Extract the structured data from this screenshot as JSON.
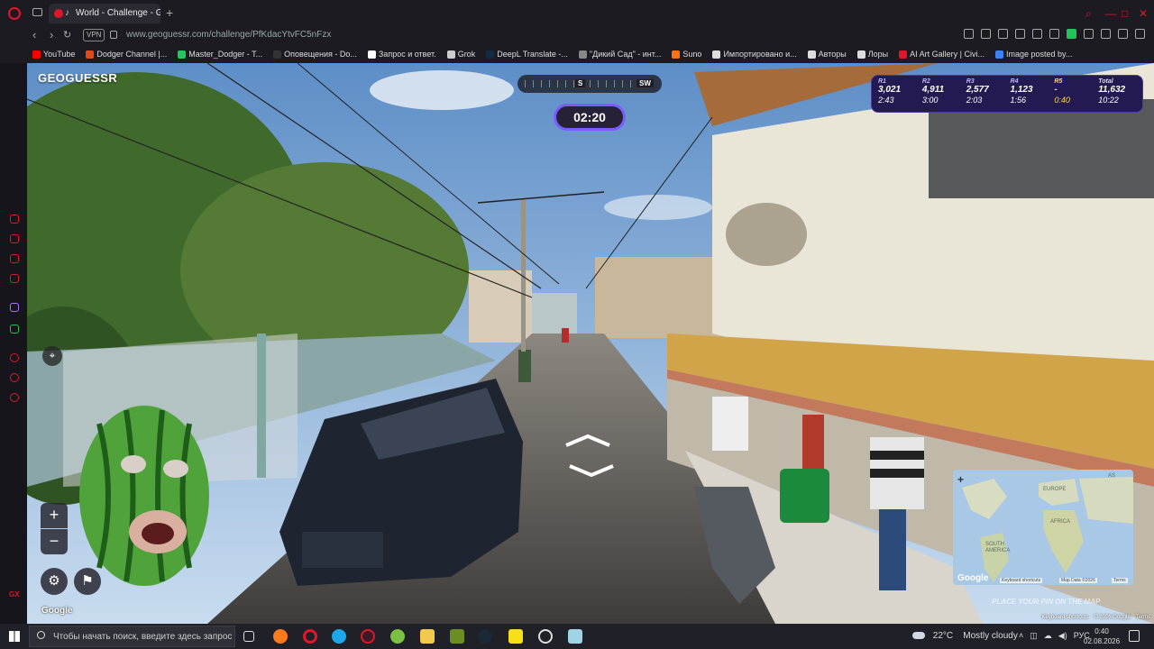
{
  "browser": {
    "tab_title": "World - Challenge - Geo",
    "url": "www.geoguessr.com/challenge/PfKdacYtvFC5nFzx",
    "vpn_label": "VPN",
    "new_tab": "+"
  },
  "bookmarks": [
    {
      "label": "YouTube",
      "color": "#ff0000"
    },
    {
      "label": "Dodger Channel |...",
      "color": "#e04a1a"
    },
    {
      "label": "Master_Dodger - T...",
      "color": "#22c55e"
    },
    {
      "label": "Оповещения - Do...",
      "color": "#333333"
    },
    {
      "label": "Запрос и ответ.",
      "color": "#ffffff"
    },
    {
      "label": "Grok",
      "color": "#cccccc"
    },
    {
      "label": "DeepL Translate -...",
      "color": "#0f2b46"
    },
    {
      "label": "\"Дикий Сад\" - инт...",
      "color": "#888888"
    },
    {
      "label": "Suno",
      "color": "#f97316"
    },
    {
      "label": "Импортировано и...",
      "color": "#dddddd"
    },
    {
      "label": "Авторы",
      "color": "#dddddd"
    },
    {
      "label": "Лоры",
      "color": "#dddddd"
    },
    {
      "label": "AI Art Gallery | Civi...",
      "color": "#e0162b"
    },
    {
      "label": "Image posted by...",
      "color": "#3b82f6"
    }
  ],
  "game": {
    "logo": "GEOGUESSR",
    "compass": {
      "s": "S",
      "sw": "SW"
    },
    "timer": "02:20",
    "rounds": [
      {
        "label": "R1",
        "points": "3,021",
        "time": "2:43"
      },
      {
        "label": "R2",
        "points": "4,911",
        "time": "3:00"
      },
      {
        "label": "R3",
        "points": "2,577",
        "time": "2:03"
      },
      {
        "label": "R4",
        "points": "1,123",
        "time": "1:56"
      },
      {
        "label": "R5",
        "points": "-",
        "time": "0:40"
      }
    ],
    "total": {
      "label": "Total",
      "points": "11,632",
      "time": "10:22"
    },
    "zoom_in": "+",
    "zoom_out": "−",
    "google_mark": "Google",
    "minimap": {
      "plus": "+",
      "europe": "EUROPE",
      "africa": "AFRICA",
      "south_america": "SOUTH AMERICA",
      "asia": "AS",
      "google": "Google",
      "shortcuts": "Keyboard shortcuts",
      "map_data": "Map Data ©2026",
      "terms": "Terms"
    },
    "place_pin": "PLACE YOUR PIN ON THE MAP",
    "footer": {
      "shortcuts": "Keyboard shortcuts",
      "copyright": "© 2026 Google",
      "terms": "Terms"
    }
  },
  "taskbar": {
    "search_placeholder": "Чтобы начать поиск, введите здесь запрос",
    "temperature": "22°C",
    "weather": "Mostly cloudy",
    "lang": "РУС",
    "time": "0:40",
    "date": "02.08.2026"
  }
}
